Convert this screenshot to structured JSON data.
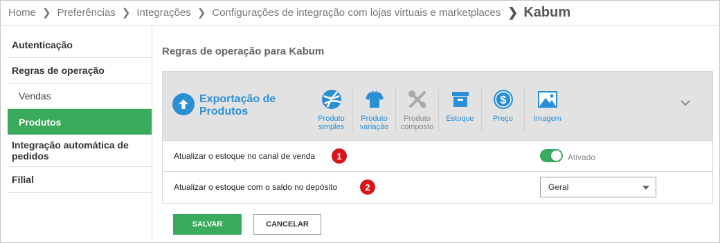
{
  "breadcrumb": {
    "items": [
      "Home",
      "Preferências",
      "Integrações",
      "Configurações de integração com lojas virtuais e marketplaces"
    ],
    "current": "Kabum"
  },
  "sidebar": {
    "items": [
      {
        "label": "Autenticação"
      },
      {
        "label": "Regras de operação"
      },
      {
        "label": "Vendas"
      },
      {
        "label": "Produtos"
      },
      {
        "label": "Integração automática de pedidos"
      },
      {
        "label": "Filial"
      }
    ],
    "active": "Produtos"
  },
  "main": {
    "title": "Regras de operação para Kabum",
    "section": {
      "title": "Exportação de Produtos",
      "icon": "arrow-up-circle-icon",
      "tabs": [
        {
          "label": "Produto simples",
          "icon": "ball-icon",
          "enabled": true
        },
        {
          "label": "Produto variação",
          "icon": "shirt-icon",
          "enabled": true
        },
        {
          "label": "Produto composto",
          "icon": "tools-icon",
          "enabled": false
        },
        {
          "label": "Estoque",
          "icon": "box-icon",
          "enabled": true
        },
        {
          "label": "Preço",
          "icon": "dollar-icon",
          "enabled": true
        },
        {
          "label": "Imagem",
          "icon": "image-icon",
          "enabled": true
        }
      ]
    },
    "rows": [
      {
        "label": "Atualizar o estoque no canal de venda",
        "badge": "1",
        "toggle_state": "on",
        "toggle_label": "Ativado"
      },
      {
        "label": "Atualizar o estoque com o saldo no depósito",
        "badge": "2",
        "select_value": "Geral"
      }
    ],
    "buttons": {
      "save": "SALVAR",
      "cancel": "CANCELAR"
    }
  },
  "colors": {
    "accent_green": "#3aaa5c",
    "link_blue": "#2b8fd6",
    "badge_red": "#d9141c",
    "header_gray": "#e2e2e2"
  }
}
